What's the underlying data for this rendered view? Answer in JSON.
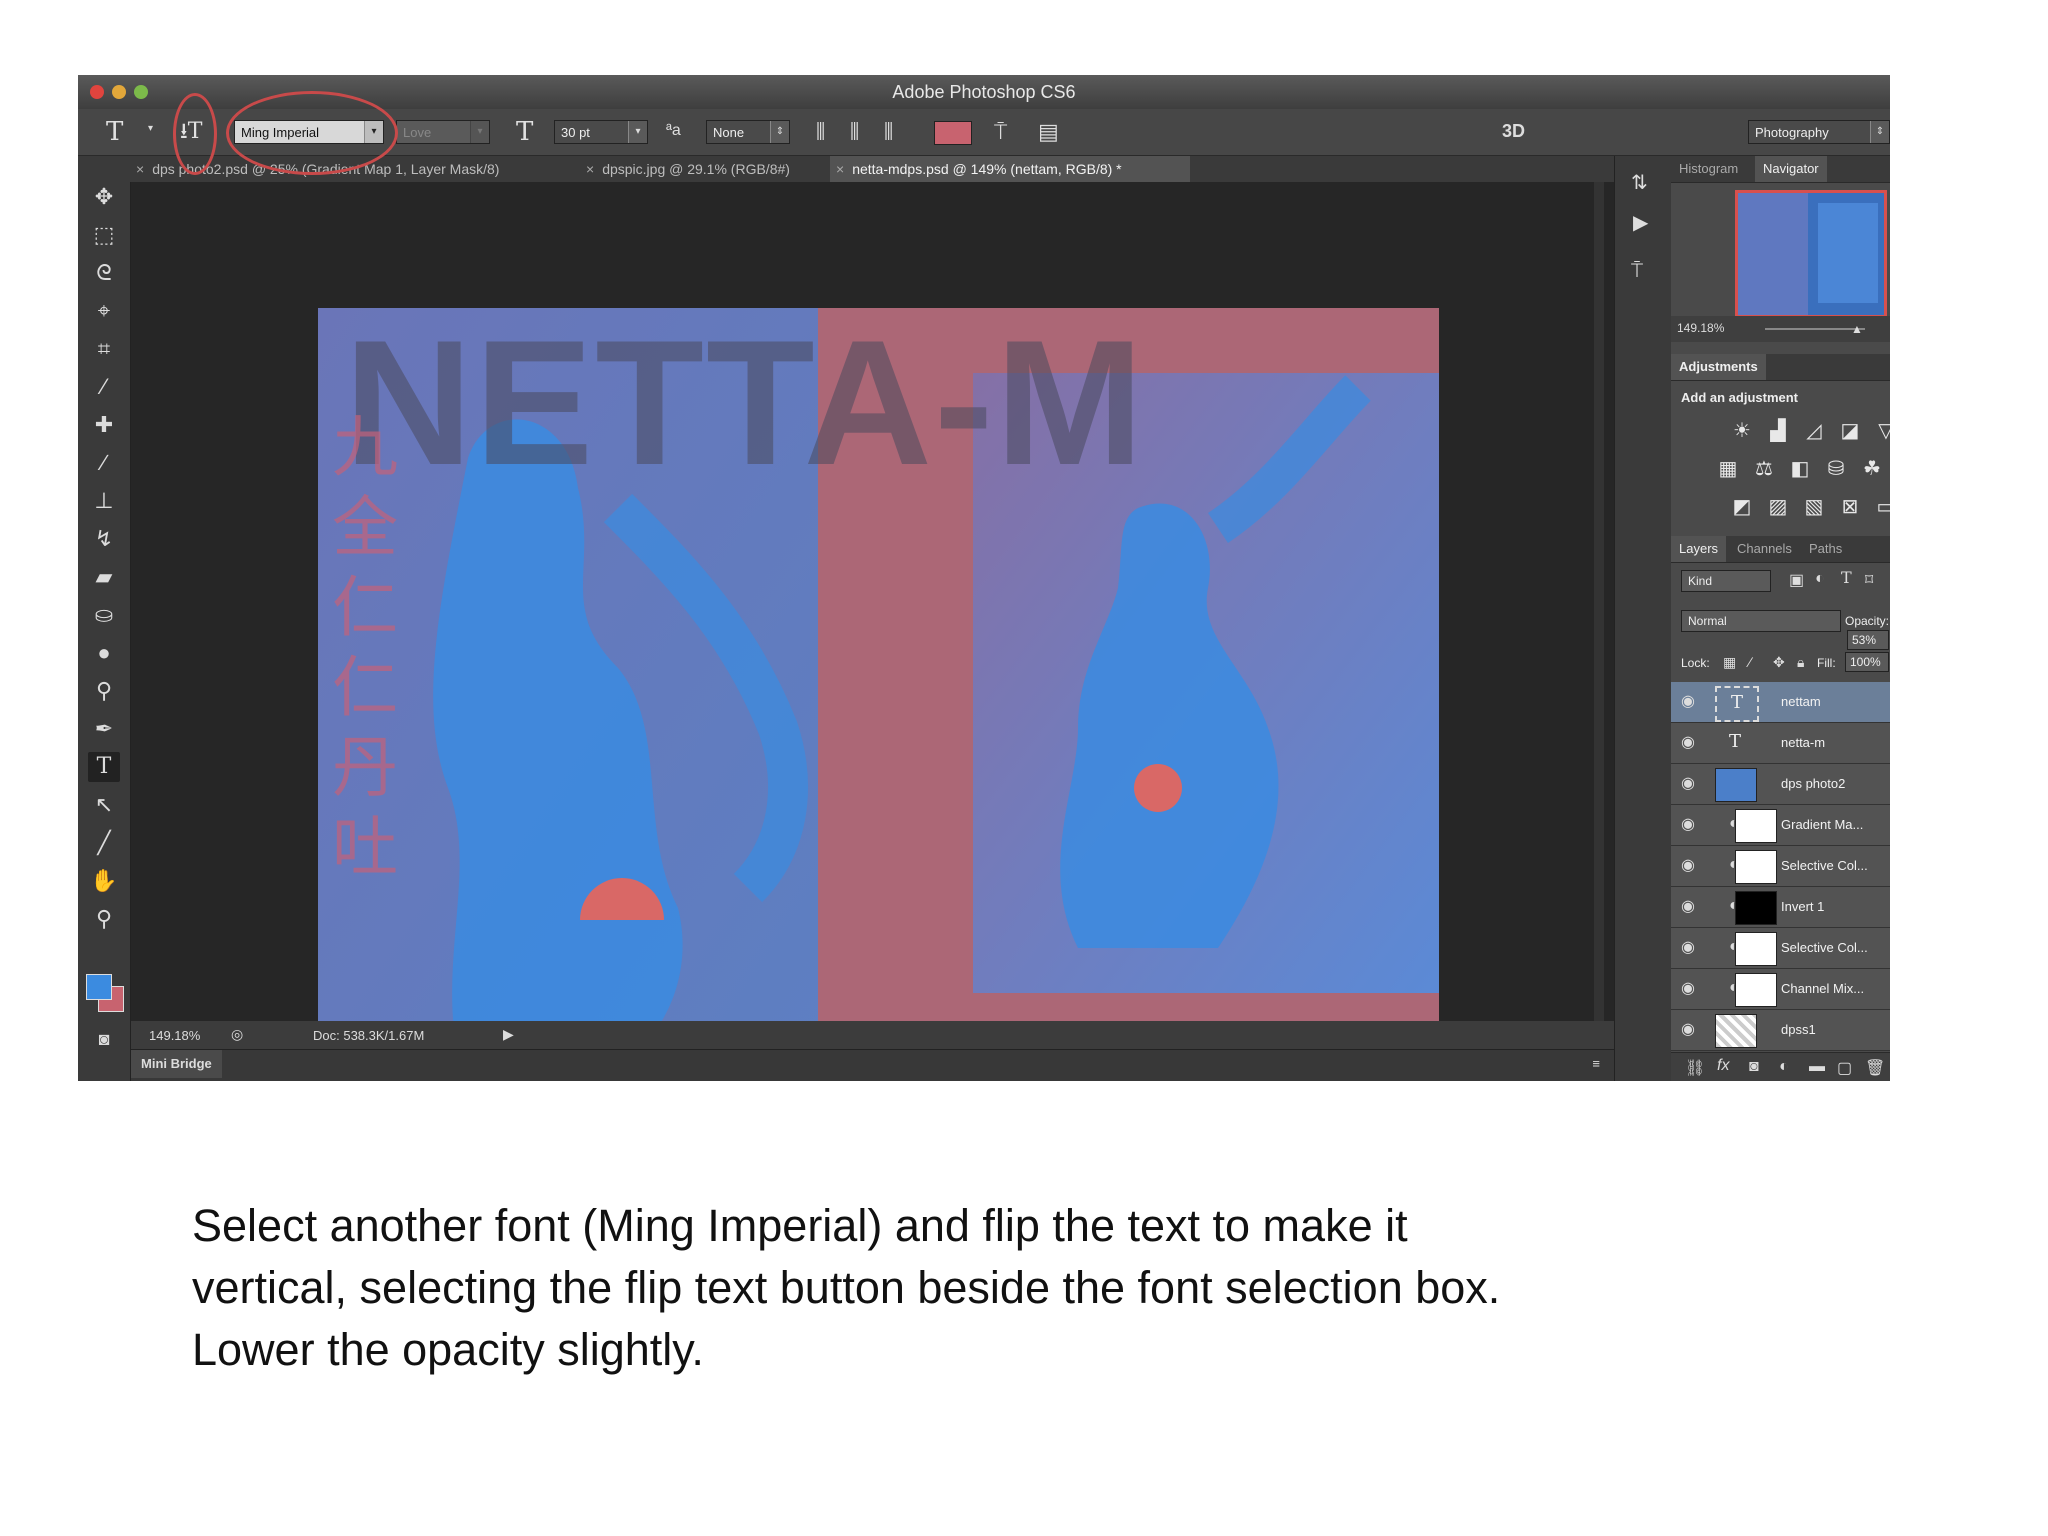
{
  "window": {
    "title": "Adobe Photoshop CS6"
  },
  "options_bar": {
    "tool_icon": "type-tool-icon",
    "orientation_toggle_icon": "toggle-text-orientation-icon",
    "font_family": "Ming Imperial",
    "font_style": "Love",
    "font_size": "30 pt",
    "aa_label": "ªa",
    "antialias": "None",
    "text_color": "#c8636f",
    "threed_label": "3D",
    "workspace": "Photography"
  },
  "tabs": [
    {
      "label": "dps photo2.psd @ 25% (Gradient Map 1, Layer Mask/8)",
      "active": false
    },
    {
      "label": "dpspic.jpg @ 29.1% (RGB/8#)",
      "active": false
    },
    {
      "label": "netta-mdps.psd @ 149% (nettam, RGB/8) *",
      "active": true
    }
  ],
  "artwork": {
    "headline": "NETTA-M",
    "vertical_text": "九全仁仁丹吐",
    "colors": {
      "pink": "#ac6776",
      "blue": "#5a86c6",
      "bright_blue": "#3b8be0",
      "red_fan": "#d96866"
    }
  },
  "status": {
    "zoom": "149.18%",
    "doc": "Doc: 538.3K/1.67M"
  },
  "mini_bridge": "Mini Bridge",
  "navigator": {
    "tabs": [
      "Histogram",
      "Navigator"
    ],
    "zoom": "149.18%"
  },
  "adjustments": {
    "title": "Adjustments",
    "subtitle": "Add an adjustment"
  },
  "layers_panel": {
    "tabs": [
      "Layers",
      "Channels",
      "Paths"
    ],
    "kind": "Kind",
    "blend_mode": "Normal",
    "opacity_label": "Opacity:",
    "opacity": "53%",
    "lock_label": "Lock:",
    "fill_label": "Fill:",
    "fill": "100%",
    "layers": [
      {
        "name": "nettam",
        "type": "text",
        "selected": true
      },
      {
        "name": "netta-m",
        "type": "text",
        "selected": false
      },
      {
        "name": "dps photo2",
        "type": "smart",
        "selected": false
      },
      {
        "name": "Gradient Ma...",
        "type": "adjustment",
        "selected": false
      },
      {
        "name": "Selective Col...",
        "type": "adjustment",
        "selected": false
      },
      {
        "name": "Invert 1",
        "type": "adjustment-dark",
        "selected": false
      },
      {
        "name": "Selective Col...",
        "type": "adjustment",
        "selected": false
      },
      {
        "name": "Channel Mix...",
        "type": "adjustment",
        "selected": false
      },
      {
        "name": "dpss1",
        "type": "image",
        "selected": false
      }
    ]
  },
  "caption": {
    "line1": "Select another font (Ming Imperial) and flip the text to make it",
    "line2": "vertical, selecting the flip text button beside the font selection box.",
    "line3": "Lower the opacity slightly."
  },
  "annotation_color": "#c84a4a"
}
